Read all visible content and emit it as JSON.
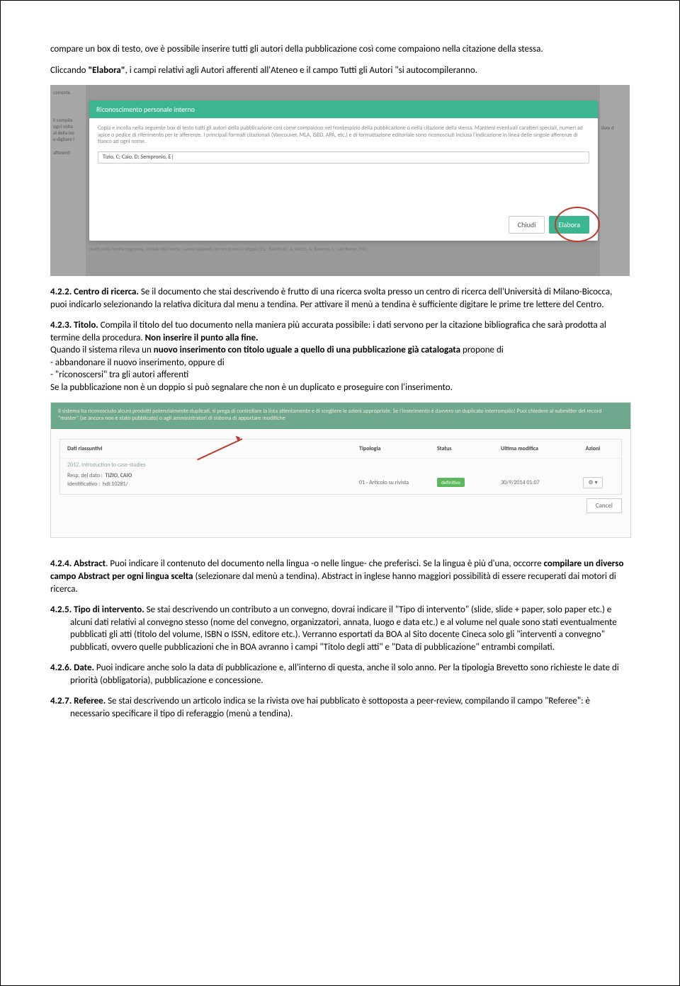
{
  "para1_a": "compare un box di testo, ove è possibile inserire tutti gli autori della pubblicazione così come compaiono nella citazione della stessa.",
  "para1_b1": "Cliccando ",
  "para1_b_bold": "\"Elabora\"",
  "para1_b2": ", i campi relativi agli Autori afferenti all'Ateneo e il campo Tutti gli Autori \"si autocompileranno.",
  "shot1": {
    "corrente": "corrente",
    "left_labels": [
      "li compila",
      "ogni volta",
      "al della ins",
      "e digitare l",
      "afferenti"
    ],
    "right_label": "ilare d",
    "header": "Riconoscimento personale interno",
    "body": "Copia e incolla nella seguente box di testo tutti gli autori della pubblicazione così come compaiono nel frontespizio della pubblicazione o nella citazione della stessa. Mantieni eventuali caratteri speciali, numeri ad apice o pedice di riferimento per le afferenze. I principali formati citazionali (Vancouver, MLA, ISBD, APA, etc.) e di formattazione editoriale sono riconosciuti inclusa l'indicazione in linea delle singole afferenze di fianco ad ogni nome.",
    "input": "Tizio, C; Caio, D; Sempronio, E|",
    "btn_close": "Chiudi",
    "btn_elabora": "Elabora",
    "footer_note": "matti nella forma cognome, iniziale del nome, vanno separati con un punto e virgola (Es.: Racchetti, A; Acoto, A; Brienne, L; van Rome, MC)"
  },
  "s422_head": "4.2.2. Centro di ricerca.",
  "s422_body": " Se il documento che stai descrivendo è frutto di una ricerca svolta presso un centro di ricerca dell'Università di Milano-Bicocca, puoi indicarlo selezionando la relativa dicitura dal menu a tendina. Per attivare il menù a tendina è sufficiente digitare le prime tre lettere del Centro.",
  "s423_head": "4.2.3. Titolo.",
  "s423_body1": " Compila il titolo del tuo documento nella maniera più accurata possibile: i dati servono per la citazione bibliografica che sarà prodotta al termine della procedura. ",
  "s423_body1_bold": "Non inserire il punto alla fine.",
  "s423_body2a": "Quando il sistema rileva un ",
  "s423_body2_bold": "nuovo inserimento con titolo uguale a quello di una pubblicazione già catalogata",
  "s423_body2b": " propone di",
  "s423_li1": "- abbandonare il nuovo inserimento, oppure di",
  "s423_li2": "- \"riconoscersi\" tra gli autori afferenti",
  "s423_body3": "Se la pubblicazione non è un doppio si può segnalare che non è un duplicato e proseguire con l'inserimento.",
  "shot2": {
    "banner": "Il sistema ha riconosciuto alcuni prodotti potenzialmente duplicati, si prega di controllare la lista attentamente e di scegliere le azioni appropriate. Se l'inserimento è davvero un duplicato interrompilo! Puoi chiedere al submitter del record \"master\" (se ancora non è stato pubblicato) o agli amministratori di sistema di apportare modifiche",
    "h_dati": "Dati riassuntivi",
    "h_tipologia": "Tipologia",
    "h_status": "Status",
    "h_ultima": "Ultima modifica",
    "h_azioni": "Azioni",
    "title": "2012. Introduction to case-studies",
    "resp_label": "Resp. del dato :",
    "resp_value": "TIZIO, CAIO",
    "id_label": "Identificativo :",
    "id_value": "hdl:10281/",
    "tipologia": "01 - Articolo su rivista",
    "status": "definitivo",
    "ultima": "30/9/2014 01:07",
    "gear": "⚙",
    "caret": "▾",
    "cancel": "Cancel"
  },
  "s424_head": "4.2.4. Abstract",
  "s424_a": ". Puoi indicare il contenuto del documento nella lingua -o nelle lingue- che preferisci. Se la lingua è più d'una, occorre ",
  "s424_bold": "compilare un diverso campo Abstract per ogni lingua scelta",
  "s424_b": " (selezionare dal menù a tendina). Abstract in inglese hanno maggiori possibilità di essere recuperati dai motori di ricerca.",
  "s425_head": "4.2.5. Tipo di intervento.",
  "s425_body": " Se stai descrivendo un contributo a un convegno, dovrai indicare il \"Tipo di intervento\" (slide, slide + paper, solo paper etc.) e alcuni dati relativi al convegno stesso (nome del convegno, organizzatori, annata, luogo e data etc.) e al volume nel quale sono stati eventualmente pubblicati gli atti (titolo del volume, ISBN o ISSN, editore etc.). Verranno esportati da BOA al Sito docente Cineca solo gli \"interventi a convegno\" pubblicati, ovvero quelle pubblicazioni che in BOA avranno i campi \"Titolo degli atti\" e \"Data di pubblicazione\" entrambi compilati.",
  "s426_head": "4.2.6. Date.",
  "s426_body": " Puoi indicare anche solo la data di pubblicazione e, all'interno di questa, anche il solo anno. Per la tipologia Brevetto sono richieste le date di priorità (obbligatoria), pubblicazione e concessione.",
  "s427_head": "4.2.7. Referee.",
  "s427_body": " Se stai descrivendo un articolo indica se la rivista ove hai pubblicato è sottoposta a peer-review, compilando il campo \"Referee\": è necessario specificare il tipo di referaggio (menù a tendina)."
}
